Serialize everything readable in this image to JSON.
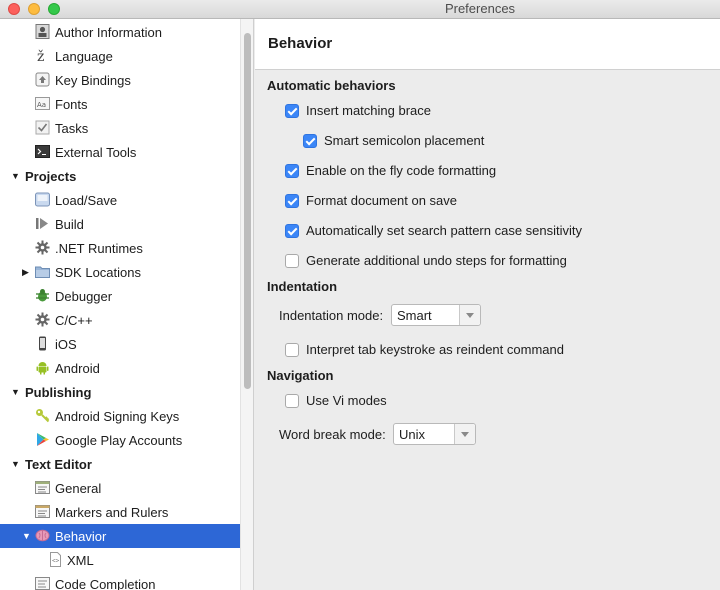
{
  "window": {
    "title": "Preferences"
  },
  "sidebar": {
    "author_information": "Author Information",
    "language": "Language",
    "key_bindings": "Key Bindings",
    "fonts": "Fonts",
    "tasks": "Tasks",
    "external_tools": "External Tools",
    "projects": "Projects",
    "load_save": "Load/Save",
    "build": "Build",
    "net_runtimes": ".NET Runtimes",
    "sdk_locations": "SDK Locations",
    "debugger": "Debugger",
    "cpp": "C/C++",
    "ios": "iOS",
    "android": "Android",
    "publishing": "Publishing",
    "android_signing_keys": "Android Signing Keys",
    "google_play_accounts": "Google Play Accounts",
    "text_editor": "Text Editor",
    "general": "General",
    "markers_and_rulers": "Markers and Rulers",
    "behavior": "Behavior",
    "xml": "XML",
    "code_completion": "Code Completion"
  },
  "page": {
    "title": "Behavior",
    "automatic_behaviors": {
      "heading": "Automatic behaviors",
      "insert_matching_brace": {
        "label": "Insert matching brace",
        "checked": true
      },
      "smart_semicolon": {
        "label": "Smart semicolon placement",
        "checked": true
      },
      "on_the_fly_formatting": {
        "label": "Enable on the fly code formatting",
        "checked": true
      },
      "format_on_save": {
        "label": "Format document on save",
        "checked": true
      },
      "search_case_sensitivity": {
        "label": "Automatically set search pattern case sensitivity",
        "checked": true
      },
      "undo_steps_formatting": {
        "label": "Generate additional undo steps for formatting",
        "checked": false
      }
    },
    "indentation": {
      "heading": "Indentation",
      "mode_label": "Indentation mode:",
      "mode_value": "Smart",
      "tab_reindent": {
        "label": "Interpret tab keystroke as reindent command",
        "checked": false
      }
    },
    "navigation": {
      "heading": "Navigation",
      "vi_modes": {
        "label": "Use Vi modes",
        "checked": false
      },
      "word_break_label": "Word break mode:",
      "word_break_value": "Unix"
    }
  },
  "colors": {
    "selection": "#2d67d6",
    "checkbox_accent": "#3b86f7"
  }
}
